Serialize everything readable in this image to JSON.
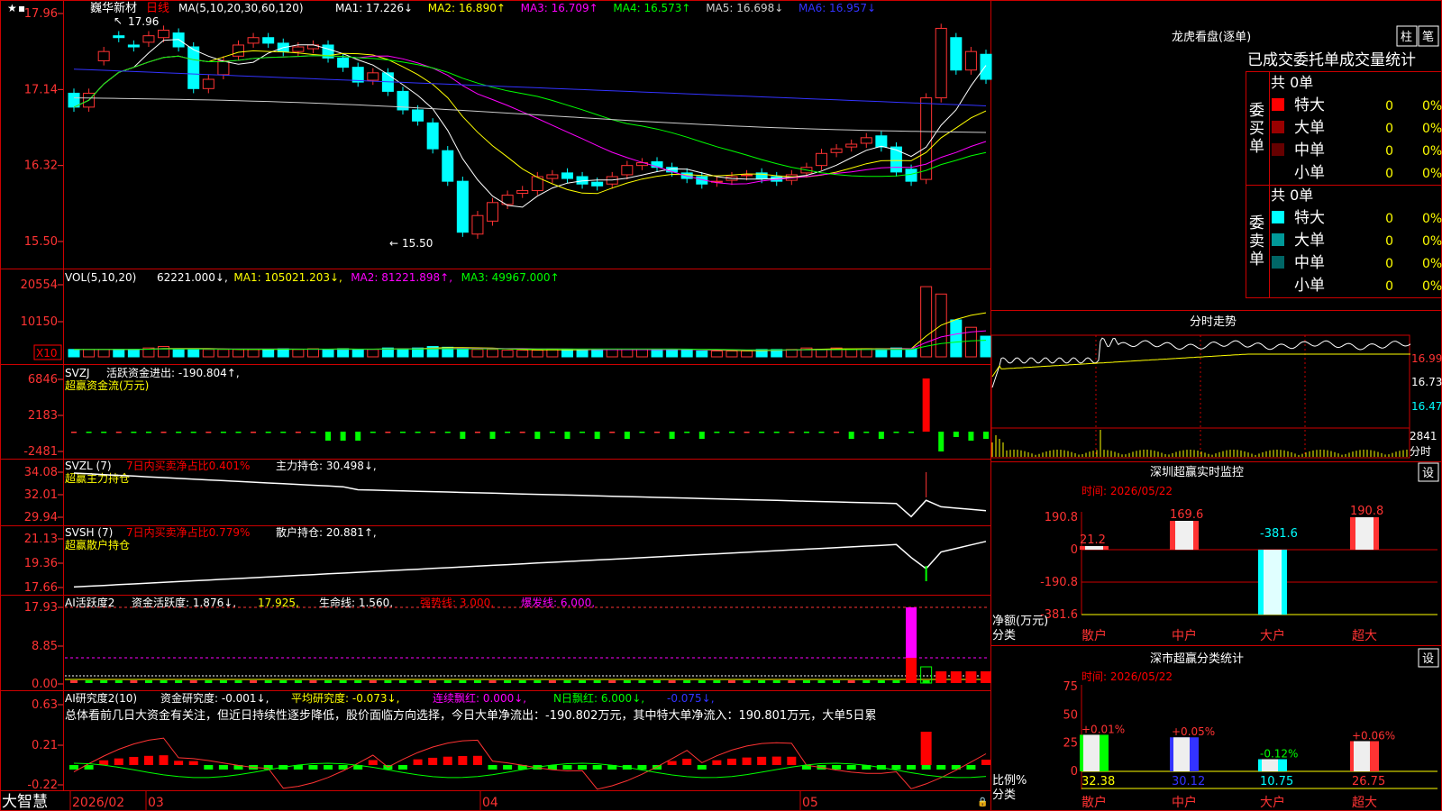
{
  "stock": {
    "name": "巍华新材",
    "period": "日线"
  },
  "kline": {
    "ma_header": "MA(5,10,20,30,60,120)",
    "ma": [
      {
        "label": "MA1: 17.226↓",
        "color": "#ffffff"
      },
      {
        "label": "MA2: 16.890↑",
        "color": "#ffff00"
      },
      {
        "label": "MA3: 16.709↑",
        "color": "#ff00ff"
      },
      {
        "label": "MA4: 16.573↑",
        "color": "#00ff00"
      },
      {
        "label": "MA5: 16.698↓",
        "color": "#cccccc"
      },
      {
        "label": "MA6: 16.957↓",
        "color": "#3333ff"
      }
    ],
    "y_ticks": [
      "17.96",
      "17.14",
      "16.32",
      "15.50"
    ],
    "high_mark": "17.96",
    "low_mark": "15.50",
    "date_labels": [
      "2026/02",
      "03",
      "04",
      "05"
    ]
  },
  "vol": {
    "header": "VOL(5,10,20)",
    "items": [
      {
        "label": "62221.000↓,",
        "color": "#ffffff"
      },
      {
        "label": "MA1: 105021.203↓,",
        "color": "#ffff00"
      },
      {
        "label": "MA2: 81221.898↑,",
        "color": "#ff00ff"
      },
      {
        "label": "MA3: 49967.000↑",
        "color": "#00ff00"
      }
    ],
    "y_ticks": [
      "20554",
      "10150"
    ],
    "unit": "X10"
  },
  "svzj": {
    "header": "SVZJ",
    "value": "活跃资金进出: -190.804↑,",
    "sub": "超赢资金流(万元)",
    "y_ticks": [
      "6846",
      "2183",
      "-2481"
    ]
  },
  "svzl": {
    "header": "SVZL (7)",
    "ratio": "7日内买卖净占比0.401%",
    "holding": "主力持仓: 30.498↓,",
    "sub": "超赢主力持仓",
    "y_ticks": [
      "34.08",
      "32.01",
      "29.94"
    ]
  },
  "svsh": {
    "header": "SVSH (7)",
    "ratio": "7日内买卖净占比0.779%",
    "holding": "散户持仓: 20.881↑,",
    "sub": "超赢散户持仓",
    "y_ticks": [
      "21.13",
      "19.36",
      "17.66"
    ]
  },
  "ai1": {
    "header": "AI活跃度2",
    "a": "资金活跃度: 1.876↓,",
    "b": "17.925,",
    "c": "生命线: 1.560,",
    "d": "强势线: 3.000,",
    "e": "爆发线: 6.000,",
    "y_ticks": [
      "17.93",
      "8.85",
      "0.00"
    ]
  },
  "ai2": {
    "header": "AI研究度2(10)",
    "a": "资金研究度: -0.001↓,",
    "b": "平均研究度: -0.073↓,",
    "c": "连续飘红: 0.000↓,",
    "d": "N日飘红: 6.000↓,",
    "e": "-0.075↓,",
    "desc": "总体看前几日大资金有关注，但近日持续性逐步降低，股价面临方向选择，今日大单净流出：-190.802万元，其中特大单净流入：190.801万元，大单5日累",
    "y_ticks": [
      "0.63",
      "0.21",
      "-0.22"
    ]
  },
  "brand": "大智慧",
  "dragon": {
    "title": "龙虎看盘(逐单)",
    "tab_zhu": "柱",
    "tab_bi": "笔",
    "cols": "已成交委托单成交量统计",
    "buy_label": "委买单",
    "sell_label": "委卖单",
    "buy_total": "共 0单",
    "sell_total": "共 0单",
    "buy_rows": [
      {
        "name": "特大",
        "n": "0",
        "p": "0%",
        "color": "#ff0000"
      },
      {
        "name": "大单",
        "n": "0",
        "p": "0%",
        "color": "#990000"
      },
      {
        "name": "中单",
        "n": "0",
        "p": "0%",
        "color": "#660000"
      },
      {
        "name": "小单",
        "n": "0",
        "p": "0%",
        "color": "#000000"
      }
    ],
    "sell_rows": [
      {
        "name": "特大",
        "n": "0",
        "p": "0%",
        "color": "#00ffff"
      },
      {
        "name": "大单",
        "n": "0",
        "p": "0%",
        "color": "#009999"
      },
      {
        "name": "中单",
        "n": "0",
        "p": "0%",
        "color": "#006666"
      },
      {
        "name": "小单",
        "n": "0",
        "p": "0%",
        "color": "#000000"
      }
    ]
  },
  "intraday": {
    "title": "分时走势",
    "y_ticks": [
      "16.99",
      "16.73",
      "16.47"
    ],
    "vol_tick": "2841",
    "vol_unit": "分时"
  },
  "sz_monitor": {
    "title": "深圳超赢实时监控",
    "settings": "设",
    "time": "时间: 2026/05/22",
    "y_ticks": [
      "190.8",
      "0",
      "-190.8",
      "-381.6"
    ],
    "ylabel": "净额(万元)",
    "xlabel": "分类",
    "categories": [
      "散户",
      "中户",
      "大户",
      "超大"
    ],
    "values": [
      21.2,
      169.6,
      -381.6,
      190.8
    ],
    "value_labels": [
      "21.2",
      "169.6",
      "-381.6",
      "190.8"
    ]
  },
  "sz_class": {
    "title": "深市超赢分类统计",
    "settings": "设",
    "time": "时间: 2026/05/22",
    "y_ticks": [
      "75",
      "50",
      "25",
      "0"
    ],
    "ylabel": "比例%",
    "xlabel": "分类",
    "categories": [
      "散户",
      "中户",
      "大户",
      "超大"
    ],
    "values": [
      32.38,
      30.12,
      10.75,
      26.75
    ],
    "changes": [
      "+0.01%",
      "+0.05%",
      "-0.12%",
      "+0.06%"
    ]
  },
  "chart_data": [
    {
      "type": "bar",
      "title": "深圳超赢实时监控",
      "ylabel": "净额(万元)",
      "xlabel": "分类",
      "categories": [
        "散户",
        "中户",
        "大户",
        "超大"
      ],
      "values": [
        21.2,
        169.6,
        -381.6,
        190.8
      ],
      "ylim": [
        -381.6,
        190.8
      ]
    },
    {
      "type": "bar",
      "title": "深市超赢分类统计",
      "ylabel": "比例%",
      "xlabel": "分类",
      "categories": [
        "散户",
        "中户",
        "大户",
        "超大"
      ],
      "values": [
        32.38,
        30.12,
        10.75,
        26.75
      ],
      "ylim": [
        0,
        75
      ]
    },
    {
      "type": "line",
      "title": "分时走势",
      "ylim": [
        16.47,
        16.99
      ]
    },
    {
      "type": "bar",
      "title": "巍华新材 日线",
      "ylim": [
        15.5,
        17.96
      ]
    }
  ]
}
